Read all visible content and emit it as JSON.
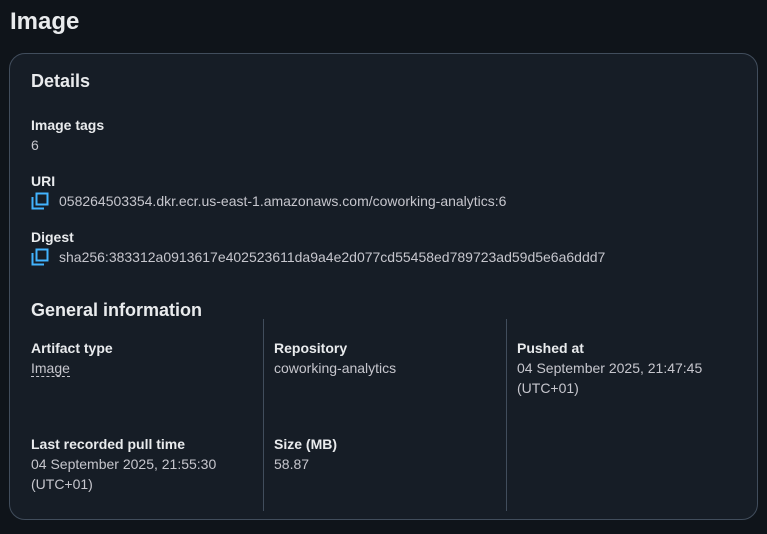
{
  "page": {
    "title": "Image"
  },
  "details": {
    "title": "Details",
    "image_tags": {
      "label": "Image tags",
      "value": "6"
    },
    "uri": {
      "label": "URI",
      "value": "058264503354.dkr.ecr.us-east-1.amazonaws.com/coworking-analytics:6"
    },
    "digest": {
      "label": "Digest",
      "value": "sha256:383312a0913617e402523611da9a4e2d077cd55458ed789723ad59d5e6a6ddd7"
    }
  },
  "general": {
    "title": "General information",
    "artifact_type": {
      "label": "Artifact type",
      "value": "Image"
    },
    "repository": {
      "label": "Repository",
      "value": "coworking-analytics"
    },
    "pushed_at": {
      "label": "Pushed at",
      "value": "04 September 2025, 21:47:45 (UTC+01)"
    },
    "last_pull": {
      "label": "Last recorded pull time",
      "value": "04 September 2025, 21:55:30 (UTC+01)"
    },
    "size": {
      "label": "Size (MB)",
      "value": "58.87"
    }
  },
  "colors": {
    "accent": "#42b4ff",
    "background": "#0f141a",
    "panel": "#161d26",
    "border": "#414d5c"
  },
  "icons": {
    "copy": "copy-icon"
  }
}
